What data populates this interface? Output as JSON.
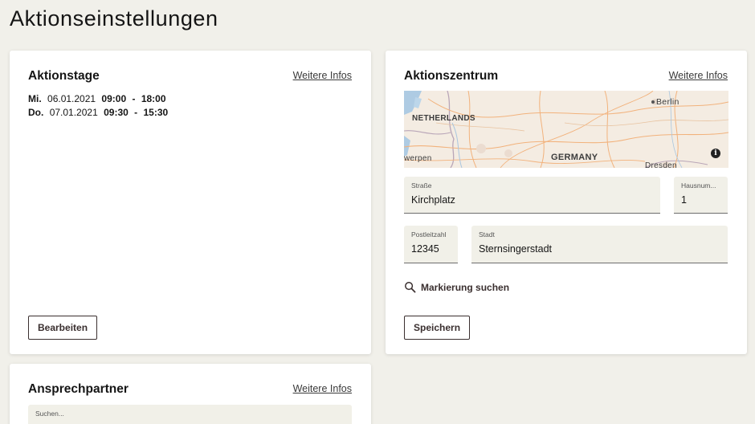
{
  "page": {
    "title": "Aktionseinstellungen"
  },
  "days_card": {
    "title": "Aktionstage",
    "more_label": "Weitere Infos",
    "days": [
      {
        "weekday": "Mi.",
        "date": "06.01.2021",
        "start": "09:00",
        "sep": "-",
        "end": "18:00"
      },
      {
        "weekday": "Do.",
        "date": "07.01.2021",
        "start": "09:30",
        "sep": "-",
        "end": "15:30"
      }
    ],
    "edit_label": "Bearbeiten"
  },
  "center_card": {
    "title": "Aktionszentrum",
    "more_label": "Weitere Infos",
    "map": {
      "labels": {
        "berlin": "Berlin",
        "netherlands": "NETHERLANDS",
        "germany": "GERMANY",
        "antwerp": "werpen",
        "dresden": "Dresden"
      },
      "info_icon": "info-icon",
      "water_color": "#aecbe3",
      "land_color": "#f4ece2"
    },
    "street": {
      "label": "Straße",
      "value": "Kirchplatz"
    },
    "house_number": {
      "label": "Hausnum...",
      "value": "1"
    },
    "postal_code": {
      "label": "Postleitzahl",
      "value": "12345"
    },
    "city": {
      "label": "Stadt",
      "value": "Sternsingerstadt"
    },
    "search_marker_label": "Markierung suchen",
    "save_label": "Speichern"
  },
  "contact_card": {
    "title": "Ansprechpartner",
    "more_label": "Weitere Infos",
    "search": {
      "label": "Suchen..."
    }
  }
}
